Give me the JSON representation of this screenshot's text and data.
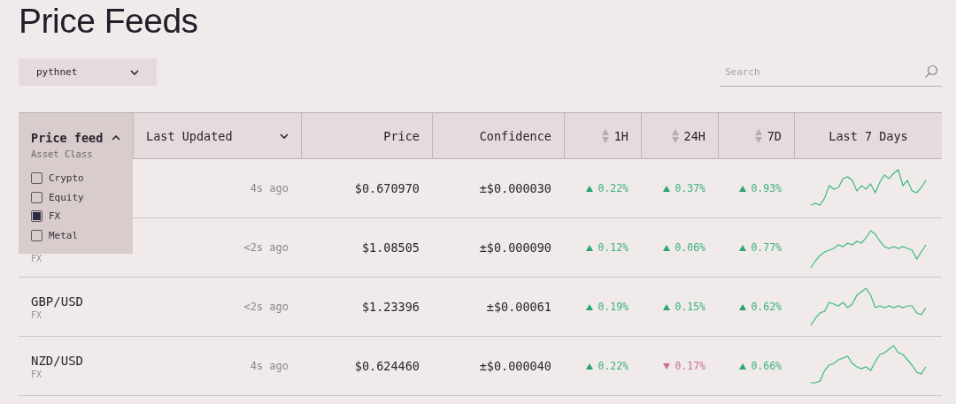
{
  "title": "Price Feeds",
  "network_select": {
    "value": "pythnet"
  },
  "search": {
    "placeholder": "Search"
  },
  "columns": [
    {
      "label": "Price feed",
      "kind": "filter",
      "expanded": true
    },
    {
      "label": "Last Updated",
      "kind": "dropdown",
      "expanded": false
    },
    {
      "label": "Price",
      "kind": "plain"
    },
    {
      "label": "Confidence",
      "kind": "plain"
    },
    {
      "label": "1H",
      "kind": "sort"
    },
    {
      "label": "24H",
      "kind": "sort"
    },
    {
      "label": "7D",
      "kind": "sort"
    },
    {
      "label": "Last 7 Days",
      "kind": "center"
    }
  ],
  "filter_panel": {
    "heading": "Asset Class",
    "options": [
      {
        "label": "Crypto",
        "checked": false
      },
      {
        "label": "Equity",
        "checked": false
      },
      {
        "label": "FX",
        "checked": true
      },
      {
        "label": "Metal",
        "checked": false
      }
    ]
  },
  "rows": [
    {
      "updated": "4s ago",
      "price": "$0.670970",
      "confidence": "±$0.000030",
      "changes": [
        {
          "value": "0.22%",
          "down": false
        },
        {
          "value": "0.37%",
          "down": false
        },
        {
          "value": "0.93%",
          "down": false
        }
      ]
    },
    {
      "category": "FX",
      "updated": "<2s ago",
      "price": "$1.08505",
      "confidence": "±$0.000090",
      "changes": [
        {
          "value": "0.12%",
          "down": false
        },
        {
          "value": "0.06%",
          "down": false
        },
        {
          "value": "0.77%",
          "down": false
        }
      ]
    },
    {
      "name": "GBP/USD",
      "category": "FX",
      "updated": "<2s ago",
      "price": "$1.23396",
      "confidence": "±$0.00061",
      "changes": [
        {
          "value": "0.19%",
          "down": false
        },
        {
          "value": "0.15%",
          "down": false
        },
        {
          "value": "0.62%",
          "down": false
        }
      ]
    },
    {
      "name": "NZD/USD",
      "category": "FX",
      "updated": "4s ago",
      "price": "$0.624460",
      "confidence": "±$0.000040",
      "changes": [
        {
          "value": "0.22%",
          "down": false
        },
        {
          "value": "0.17%",
          "down": true
        },
        {
          "value": "0.66%",
          "down": false
        }
      ]
    }
  ]
}
